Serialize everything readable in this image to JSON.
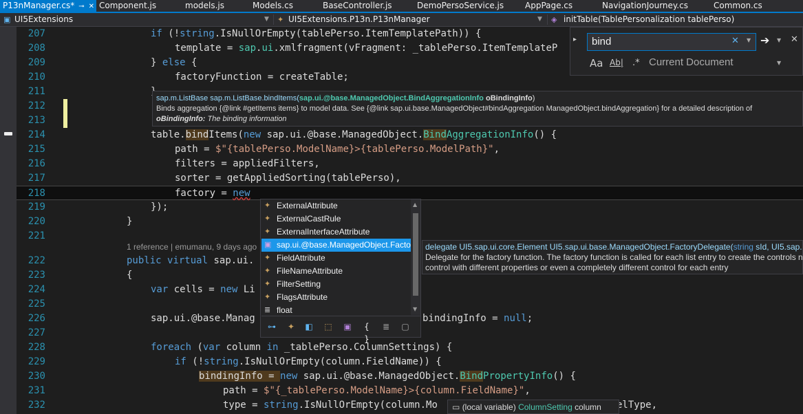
{
  "tabs": [
    {
      "label": "P13nManager.cs*",
      "active": true,
      "pin": "⊸",
      "close": "✕"
    },
    {
      "label": "Component.js"
    },
    {
      "label": "models.js"
    },
    {
      "label": "Models.cs"
    },
    {
      "label": "BaseController.js"
    },
    {
      "label": "DemoPersoService.js"
    },
    {
      "label": "AppPage.cs"
    },
    {
      "label": "NavigationJourney.cs"
    },
    {
      "label": "Common.cs"
    }
  ],
  "navbar": {
    "project": "UI5Extensions",
    "type": "UI5Extensions.P13n.P13nManager",
    "member": "initTable(TablePersonalization tablePerso)"
  },
  "find": {
    "query": "bind",
    "clear": "✕",
    "scope": "Current Document",
    "match_case": "Aa",
    "whole_word": "Ab|",
    "regex": ".*",
    "next": "➔",
    "close": "✕"
  },
  "lines": [
    {
      "n": "207"
    },
    {
      "n": "208"
    },
    {
      "n": "209"
    },
    {
      "n": "210"
    },
    {
      "n": "211"
    },
    {
      "n": "212"
    },
    {
      "n": "213"
    },
    {
      "n": "214"
    },
    {
      "n": "215"
    },
    {
      "n": "216"
    },
    {
      "n": "217"
    },
    {
      "n": "218"
    },
    {
      "n": "219"
    },
    {
      "n": "220"
    },
    {
      "n": "221"
    },
    {
      "n": "222"
    },
    {
      "n": "223"
    },
    {
      "n": "224"
    },
    {
      "n": "225"
    },
    {
      "n": "226"
    },
    {
      "n": "227"
    },
    {
      "n": "228"
    },
    {
      "n": "229"
    },
    {
      "n": "230"
    },
    {
      "n": "231"
    },
    {
      "n": "232"
    }
  ],
  "code": {
    "l207": [
      "if",
      " (!",
      "string",
      ".IsNullOrEmpty(tablePerso.ItemTemplatePath)) {"
    ],
    "l208": [
      "template = ",
      "sap",
      ".",
      "ui",
      ".xmlfragment(vFragment: _tablePerso.ItemTemplateP"
    ],
    "l209": [
      "} ",
      "else",
      " {"
    ],
    "l210": [
      "factoryFunction = createTable;"
    ],
    "l211": [
      "}"
    ],
    "l214": [
      "table.",
      "bind",
      "Items(",
      "new",
      " sap.ui.@base.ManagedObject.",
      "Bind",
      "AggregationInfo",
      "() {"
    ],
    "l215": [
      "path = ",
      "$\"{tablePerso.ModelName}>{tablePerso.ModelPath}\"",
      ","
    ],
    "l216": [
      "filters = appliedFilters,"
    ],
    "l217": [
      "sorter = getAppliedSorting(tablePerso),"
    ],
    "l218": [
      "factory = ",
      "new"
    ],
    "l219": [
      "});"
    ],
    "l220": [
      "}"
    ],
    "l222": [
      "public",
      " ",
      "virtual",
      " sap.ui."
    ],
    "l223": [
      "{"
    ],
    "l224": [
      "var",
      " cells = ",
      "new",
      " Li"
    ],
    "l226": [
      "sap.ui.@base.Manag",
      "bindingInfo = ",
      "null",
      ";"
    ],
    "l228": [
      "foreach",
      " (",
      "var",
      " column ",
      "in",
      " _tablePerso.ColumnSettings) {"
    ],
    "l229": [
      "if",
      " (!",
      "string",
      ".IsNullOrEmpty(column.FieldName)) {"
    ],
    "l230": [
      "bindingInfo = ",
      "new",
      " sap.ui.@base.ManagedObject.",
      "Bind",
      "PropertyInfo",
      "() {"
    ],
    "l231": [
      "path = ",
      "$\"{_tablePerso.ModelName}>{column.FieldName}\"",
      ","
    ],
    "l232": [
      "type = ",
      "string",
      ".IsNullOrEmpty(column.Mo",
      "elType,"
    ]
  },
  "codelens": "1 reference | emumanu, 9 days ago",
  "sig_help": {
    "signature_prefix": "sap.m.ListBase sap.m.ListBase.bindItems(",
    "param_type": "sap.ui.@base.ManagedObject.BindAggregationInfo",
    "param_name": "oBindingInfo",
    "close": ")",
    "description": "Binds aggregation {@link #getItems items} to model data. See {@link sap.ui.base.ManagedObject#bindAggregation ManagedObject.bindAggregation} for a detailed description of",
    "param_label": "oBindingInfo:",
    "param_desc": "The binding information"
  },
  "completion": {
    "items": [
      {
        "label": "ExternalAttribute",
        "icon": "class-icon"
      },
      {
        "label": "ExternalCastRule",
        "icon": "class-icon"
      },
      {
        "label": "ExternalInterfaceAttribute",
        "icon": "class-icon"
      },
      {
        "label": "sap.ui.@base.ManagedObject.Factor",
        "icon": "delegate-icon",
        "selected": true
      },
      {
        "label": "FieldAttribute",
        "icon": "class-icon"
      },
      {
        "label": "FileNameAttribute",
        "icon": "class-icon"
      },
      {
        "label": "FilterSetting",
        "icon": "class-icon"
      },
      {
        "label": "FlagsAttribute",
        "icon": "class-icon"
      },
      {
        "label": "float",
        "icon": "keyword-icon"
      }
    ],
    "filters": [
      "⊶",
      "✦",
      "◧",
      "⬚",
      "▣",
      "{ }",
      "≣",
      "▢"
    ]
  },
  "item_tip": {
    "line1_prefix": "delegate UI5.sap.ui.core.Element UI5.sap.ui.base.ManagedObject.FactoryDelegate(",
    "line1_kw": "string",
    "line1_rest": " sId, UI5.sap.ui.m",
    "line2": "Delegate for the factory function. The factory function is called for each list entry to create the controls n",
    "line3": "control with different properties or even a completely different control for each entry"
  },
  "qinfo": {
    "prefix": "(local variable) ",
    "type": "ColumnSetting",
    "name": " column"
  }
}
